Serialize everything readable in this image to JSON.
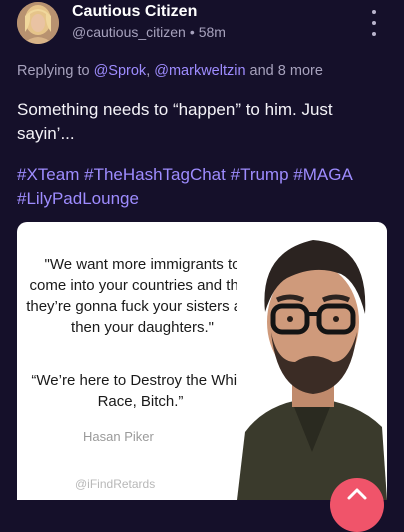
{
  "author": {
    "display_name": "Cautious Citizen",
    "handle": "@cautious_citizen",
    "time": "58m"
  },
  "reply": {
    "prefix": "Replying to",
    "mentions": [
      "@Sprok",
      "@markweltzin"
    ],
    "suffix": "and 8 more"
  },
  "post": {
    "text": "Something needs to “happen” to him. Just sayin’...",
    "hashtags": [
      "#XTeam",
      "#TheHashTagChat",
      "#Trump",
      "#MAGA",
      "#LilyPadLounge"
    ]
  },
  "image": {
    "quote1": "\"We want more immigrants to come into your countries and then they’re gonna fuck your sisters and then your daughters.\"",
    "quote2": "“We’re here to Destroy the White Race, Bitch.”",
    "attribution": "Hasan Piker",
    "watermark": "@iFindRetards"
  },
  "icons": {
    "more": "more-vertical-icon",
    "compose": "compose-icon"
  },
  "colors": {
    "background": "#15102a",
    "accent": "#9e8cff",
    "fab": "#f0546a"
  }
}
